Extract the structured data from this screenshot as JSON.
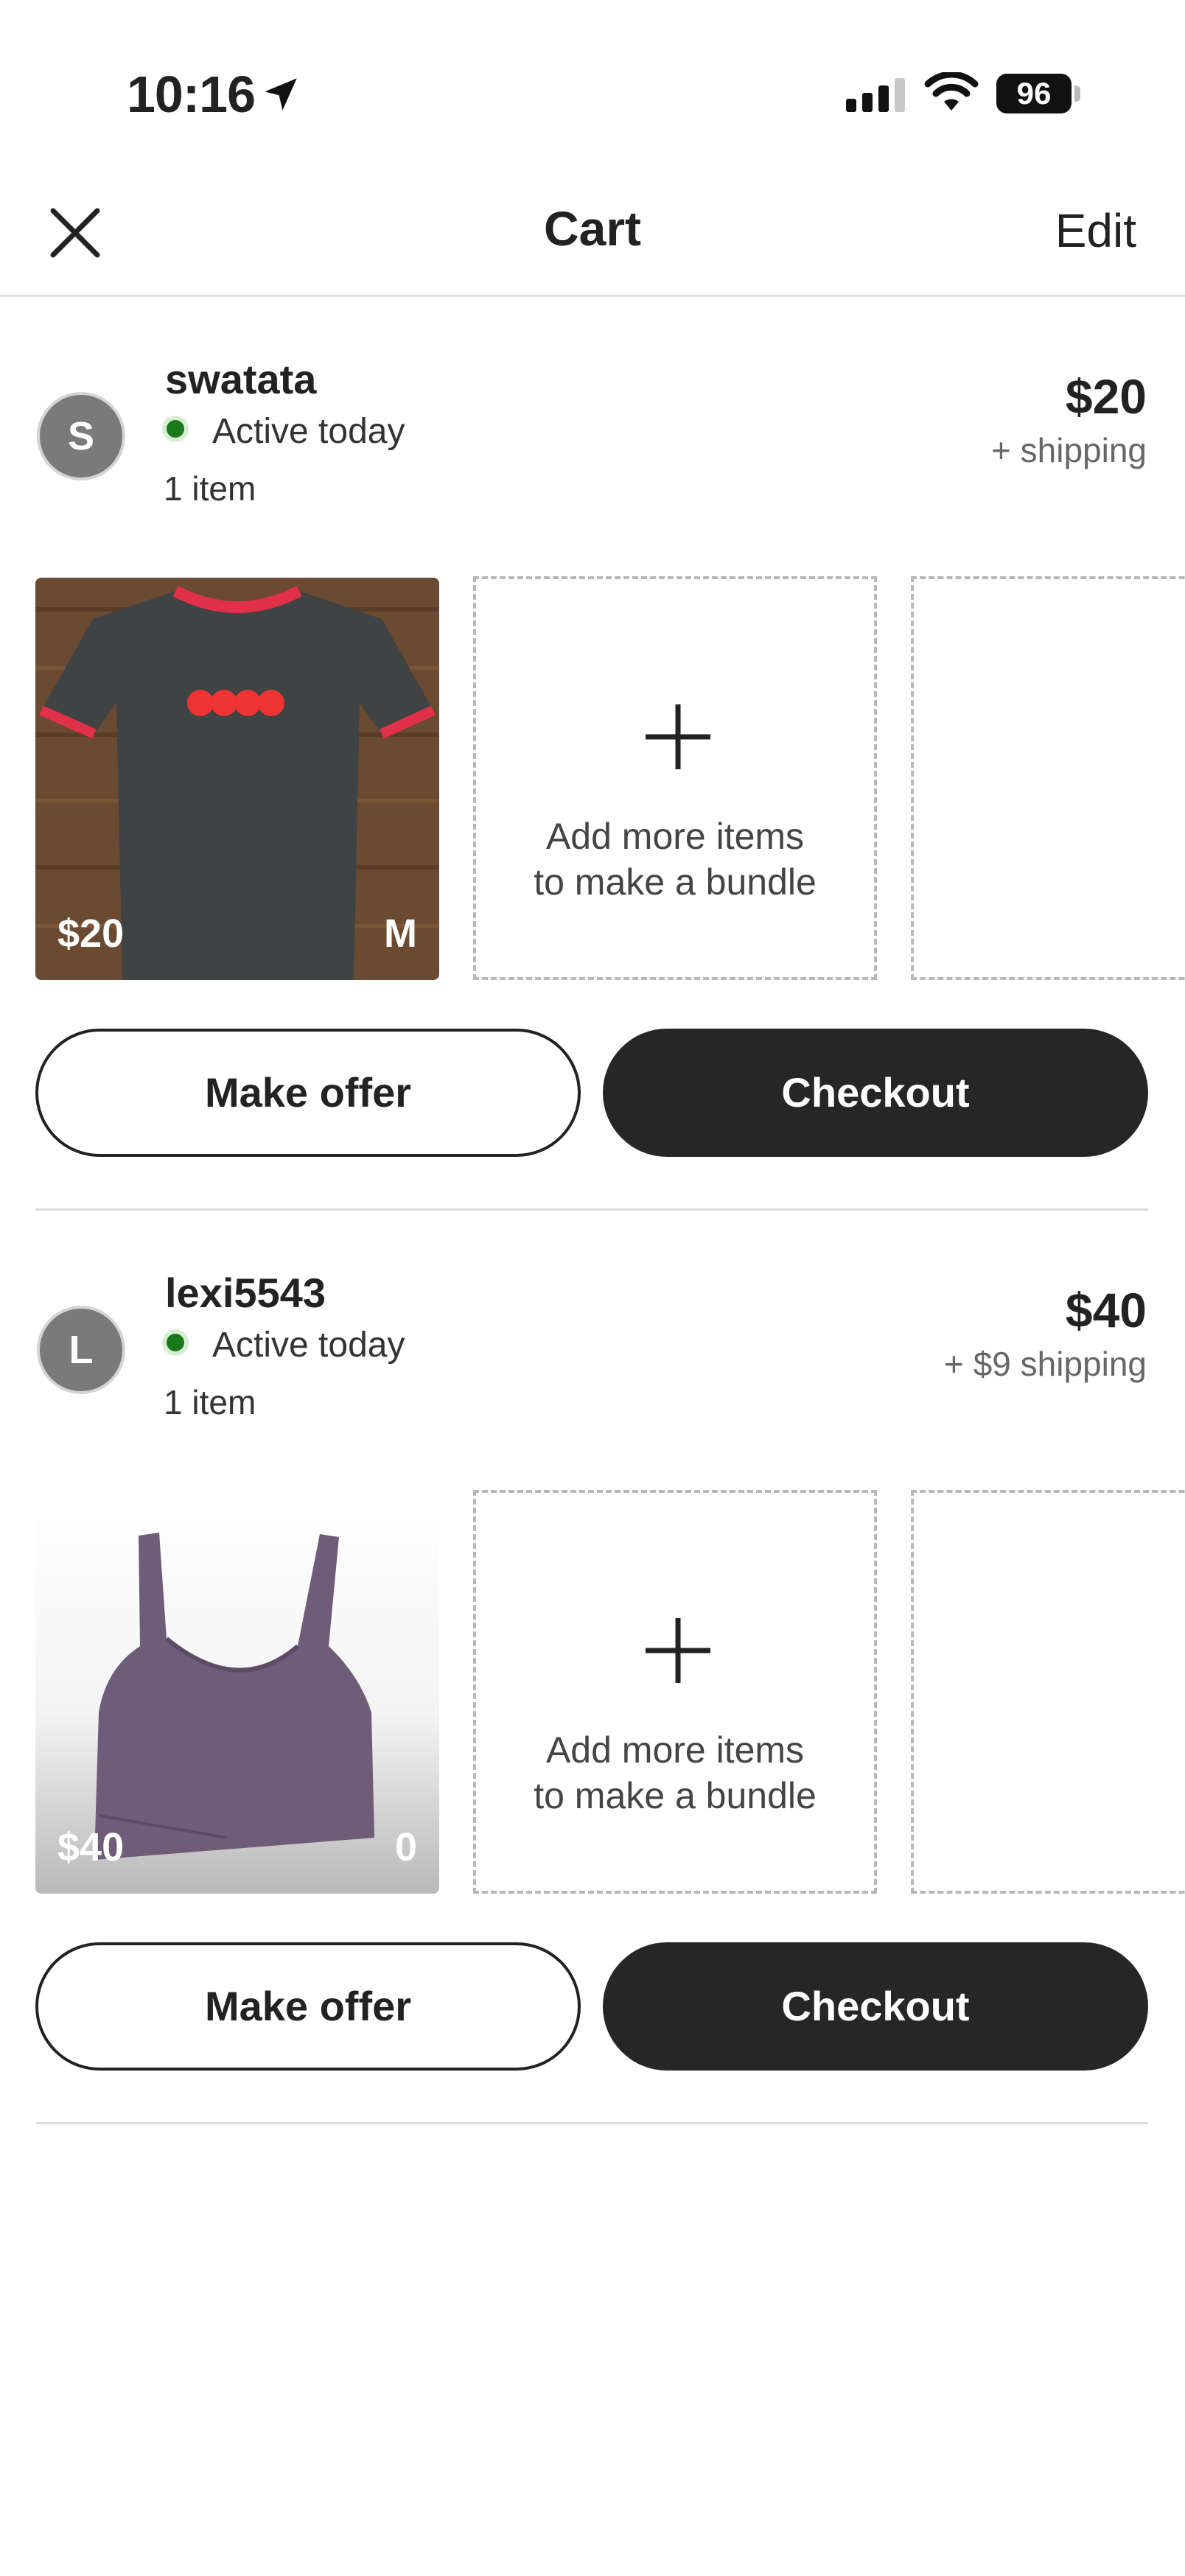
{
  "status_bar": {
    "time": "10:16",
    "battery": "96"
  },
  "nav": {
    "title": "Cart",
    "edit": "Edit"
  },
  "sellers": [
    {
      "avatar_letter": "S",
      "name": "swatata",
      "status": "Active today",
      "item_count": "1 item",
      "price": "$20",
      "shipping": "+ shipping",
      "item": {
        "price": "$20",
        "size": "M"
      },
      "bundle_text": [
        "Add more items",
        "to make a bundle"
      ],
      "offer_label": "Make offer",
      "checkout_label": "Checkout"
    },
    {
      "avatar_letter": "L",
      "name": "lexi5543",
      "status": "Active today",
      "item_count": "1 item",
      "price": "$40",
      "shipping": "+ $9 shipping",
      "item": {
        "price": "$40",
        "size": "0"
      },
      "bundle_text": [
        "Add more items",
        "to make a bundle"
      ],
      "offer_label": "Make offer",
      "checkout_label": "Checkout"
    }
  ],
  "colors": {
    "checkout_bg": "#262626",
    "active_green": "#1a7a1a",
    "avatar_gray": "#7a7a7a"
  }
}
